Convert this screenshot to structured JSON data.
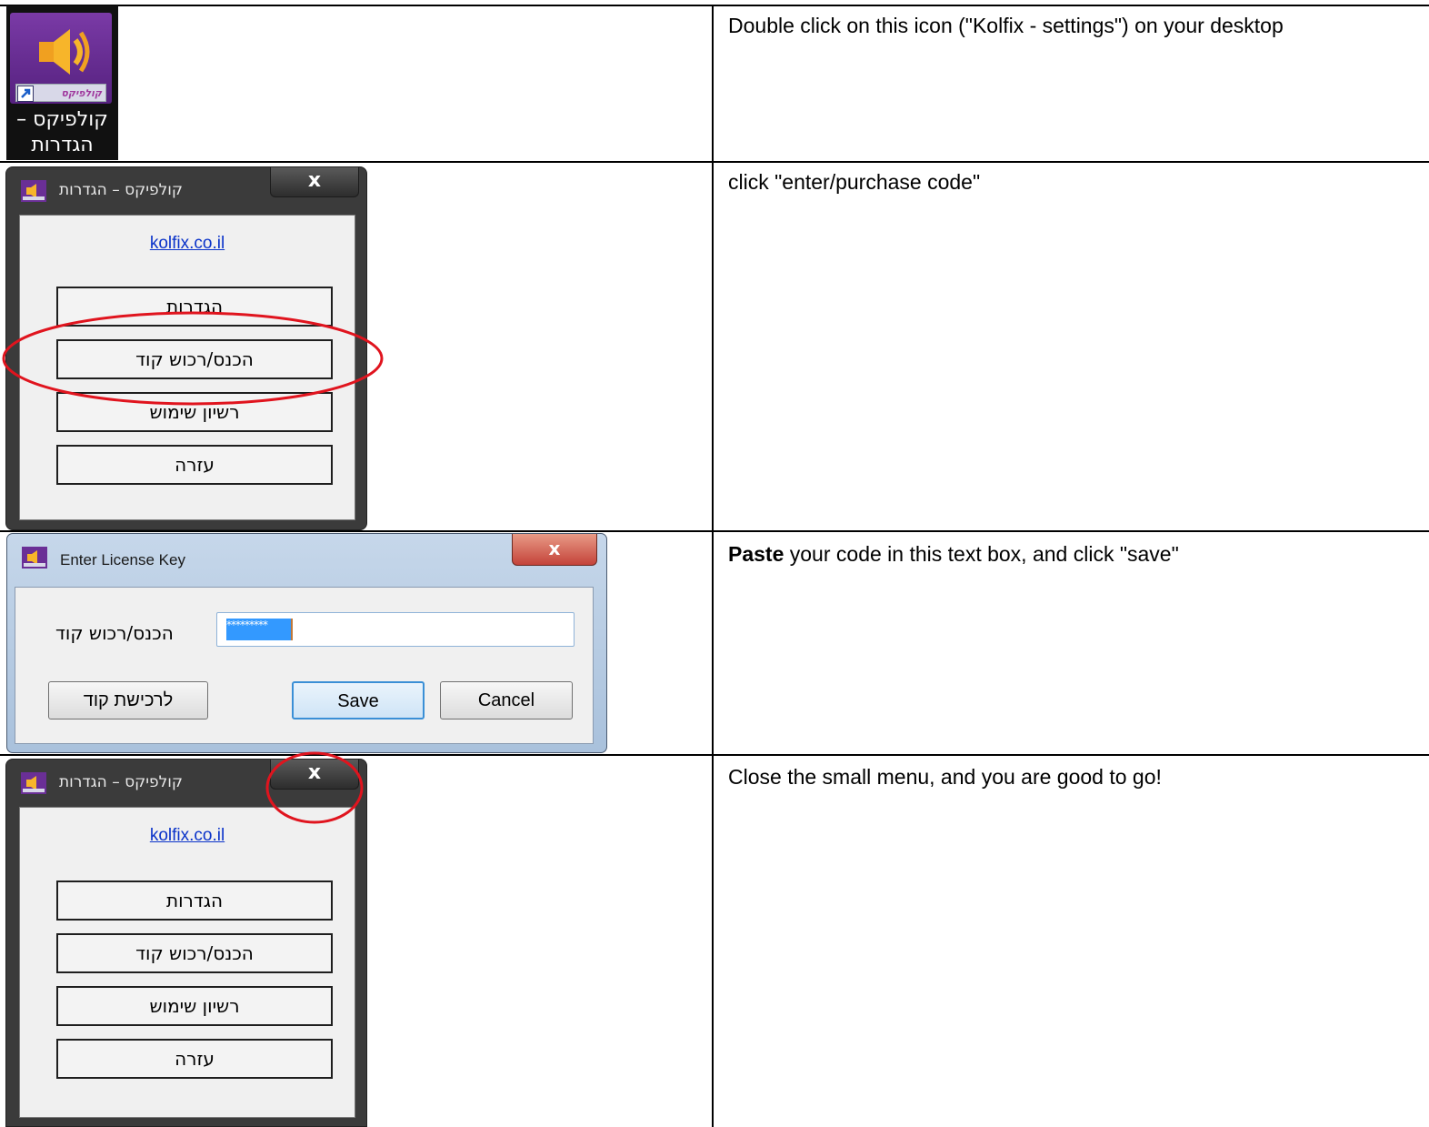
{
  "rows": [
    {
      "text": "Double click on this icon (\"Kolfix - settings\") on your desktop"
    },
    {
      "text": "click \"enter/purchase code\""
    },
    {
      "bold": "Paste",
      "text": " your code in this text box, and click \"save\""
    },
    {
      "text": "Close the small menu, and you are good to go!"
    }
  ],
  "desktop_icon": {
    "label": "קולפיקס – הגדרות",
    "badge": "קולפיקס"
  },
  "menu_window": {
    "title": "קולפיקס – הגדרות",
    "close": "x",
    "link": "kolfix.co.il",
    "buttons": [
      "הגדרות",
      "הכנס/רכוש קוד",
      "רשיון שימוש",
      "עזרה"
    ]
  },
  "license_dialog": {
    "title": "Enter License Key",
    "close": "x",
    "field_label": "הכנס/רכוש קוד",
    "field_value": "*********",
    "buy_button": "לרכישת קוד",
    "save_button": "Save",
    "cancel_button": "Cancel"
  },
  "colors": {
    "annotation": "#e0141e",
    "link": "#0a33c9",
    "window_frame": "#3b3b3b"
  }
}
